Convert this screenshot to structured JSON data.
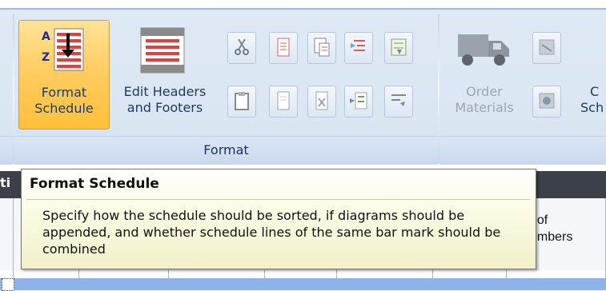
{
  "ribbon": {
    "buttons": {
      "format_schedule": {
        "label_line1": "Format",
        "label_line2": "Schedule"
      },
      "edit_headers": {
        "label_line1": "Edit Headers",
        "label_line2": "and Footers"
      },
      "order_materials": {
        "label_line1": "Order",
        "label_line2": "Materials"
      },
      "partial_next": {
        "label_line1": "C",
        "label_line2": "Sch"
      }
    },
    "group_label": "Format"
  },
  "grid": {
    "header_cut_left": "ti",
    "header_cut_right_line1": ". of",
    "header_cut_right_line2": "embers"
  },
  "tooltip": {
    "title": "Format Schedule",
    "body": "Specify how the schedule should be sorted, if diagrams should be appended, and whether schedule lines of the same bar mark should be combined"
  },
  "colors": {
    "accent_active": "#ffc84a",
    "ribbon_bg": "#dbe6f3",
    "tooltip_bg": "#f8f7d8"
  }
}
